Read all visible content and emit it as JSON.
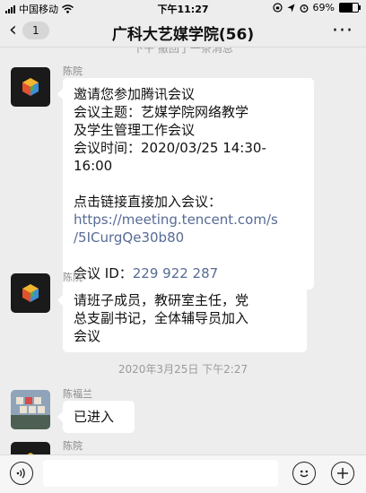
{
  "status_bar": {
    "carrier": "中国移动",
    "time": "下午11:27",
    "battery_text": "69%",
    "battery_level": 0.69
  },
  "nav": {
    "back_badge": "1",
    "title": "广科大艺媒学院(56)",
    "more": "···"
  },
  "clipped_system_text": "下午  撤回了一条消息",
  "messages": [
    {
      "sender": "陈院",
      "lines": [
        {
          "text": "邀请您参加腾讯会议",
          "type": "text"
        },
        {
          "text": "会议主题：艺媒学院网络教学",
          "type": "text"
        },
        {
          "text": "及学生管理工作会议",
          "type": "text"
        },
        {
          "text": "会议时间：2020/03/25 14:30-",
          "type": "text"
        },
        {
          "text": "16:00",
          "type": "text"
        },
        {
          "text": "",
          "type": "gap"
        },
        {
          "text": "点击链接直接加入会议：",
          "type": "text"
        },
        {
          "text": "https://meeting.tencent.com/s",
          "type": "link"
        },
        {
          "text": "/5ICurgQe30b80",
          "type": "link"
        },
        {
          "text": "",
          "type": "gap"
        }
      ],
      "meeting_id_label": "会议 ID：",
      "meeting_id_value": "229 922 287"
    },
    {
      "sender": "陈院",
      "lines": [
        {
          "text": "请班子成员，教研室主任，党",
          "type": "text"
        },
        {
          "text": "总支副书记，全体辅导员加入",
          "type": "text"
        },
        {
          "text": "会议",
          "type": "text"
        }
      ]
    },
    {
      "sender": "陈福兰",
      "lines": [
        {
          "text": "已进入",
          "type": "text"
        }
      ]
    },
    {
      "sender": "陈院",
      "lines": []
    }
  ],
  "timestamp": "2020年3月25日 下午2:27",
  "input_bar": {
    "placeholder": ""
  },
  "icons": {
    "voice": "voice-icon",
    "emoji": "emoji-icon",
    "plus": "plus-icon"
  },
  "colors": {
    "link": "#576b95",
    "background": "#ededed"
  }
}
